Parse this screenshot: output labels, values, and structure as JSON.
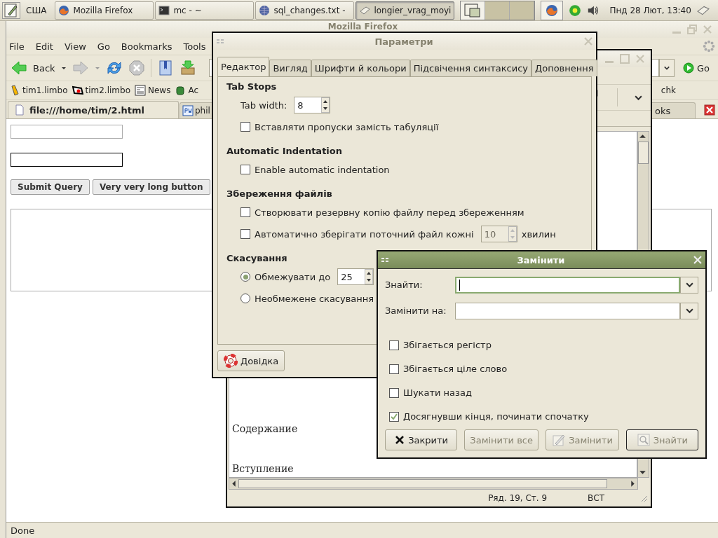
{
  "panel": {
    "layout": "США",
    "tasks": [
      {
        "label": "Mozilla Firefox",
        "selected": false
      },
      {
        "label": "mc - ~",
        "selected": false
      },
      {
        "label": "sql_changes.txt -",
        "selected": false
      },
      {
        "label": "longier_vrag_moyi",
        "selected": true
      }
    ],
    "clock": "Пнд 28 Лют, 13:40"
  },
  "firefox": {
    "title": "Mozilla Firefox",
    "menu": [
      "File",
      "Edit",
      "View",
      "Go",
      "Bookmarks",
      "Tools"
    ],
    "back": "Back",
    "go": "Go",
    "bookmarks": [
      "tim1.limbo",
      "tim2.limbo",
      "News",
      "Ac"
    ],
    "bookmark_right": "chk",
    "tabs": [
      {
        "label": "file:///home/tim/2.html",
        "selected": true
      },
      {
        "label": "phil",
        "selected": false
      },
      {
        "label": "oks",
        "selected": false
      }
    ],
    "page": {
      "fields": [
        {
          "focused": false
        },
        {
          "focused": true
        }
      ],
      "buttons": [
        "Submit Query",
        "Very very long button"
      ]
    },
    "status": "Done"
  },
  "editor": {
    "lines": [
      "Содержание",
      "Вступление"
    ],
    "position": "Ряд. 19, Ст. 9",
    "mode": "ВСТ"
  },
  "preferences": {
    "title": "Параметри",
    "active": false,
    "tabs": [
      {
        "label": "Редактор",
        "selected": true
      },
      {
        "label": "Вигляд",
        "selected": false
      },
      {
        "label": "Шрифти й кольори",
        "selected": false
      },
      {
        "label": "Підсвічення синтаксису",
        "selected": false
      },
      {
        "label": "Доповнення",
        "selected": false
      }
    ],
    "sections": [
      {
        "title": "Tab Stops",
        "items": [
          {
            "kind": "spin",
            "label": "Tab width:",
            "spin": {
              "value": "8",
              "disabled": false
            }
          },
          {
            "kind": "checkbox",
            "label": "Вставляти пропуски замість табуляції",
            "checked": false
          }
        ]
      },
      {
        "title": "Automatic Indentation",
        "items": [
          {
            "kind": "checkbox",
            "label": "Enable automatic indentation",
            "checked": false
          }
        ]
      },
      {
        "title": "Збереження файлів",
        "items": [
          {
            "kind": "checkbox",
            "label": "Створювати резервну копію файлу перед збереженням",
            "checked": false
          },
          {
            "kind": "checkbox",
            "label": "Автоматично зберігати поточний файл кожні",
            "checked": false,
            "spin": {
              "value": "10",
              "disabled": true
            },
            "suffix": "хвилин"
          }
        ]
      },
      {
        "title": "Скасування",
        "items": [
          {
            "kind": "radio",
            "label": "Обмежувати до",
            "selected": true,
            "spin": {
              "value": "25",
              "disabled": false
            }
          },
          {
            "kind": "radio",
            "label": "Необмежене скасування",
            "selected": false
          }
        ]
      }
    ],
    "help": "Довідка"
  },
  "replace": {
    "title": "Замінити",
    "active": true,
    "fields": [
      {
        "label": "Знайти:",
        "focused": true
      },
      {
        "label": "Замінити на:",
        "focused": false
      }
    ],
    "options": [
      {
        "label": "Збігається регістр",
        "checked": false
      },
      {
        "label": "Збігається ціле слово",
        "checked": false
      },
      {
        "label": "Шукати назад",
        "checked": false
      },
      {
        "label": "Досягнувши кінця, починати спочатку",
        "checked": true
      }
    ],
    "buttons": [
      {
        "label": "Закрити",
        "disabled": false,
        "default": false
      },
      {
        "label": "Замінити все",
        "disabled": true,
        "default": false
      },
      {
        "label": "Замінити",
        "disabled": true,
        "default": false
      },
      {
        "label": "Знайти",
        "disabled": true,
        "default": true
      }
    ]
  }
}
